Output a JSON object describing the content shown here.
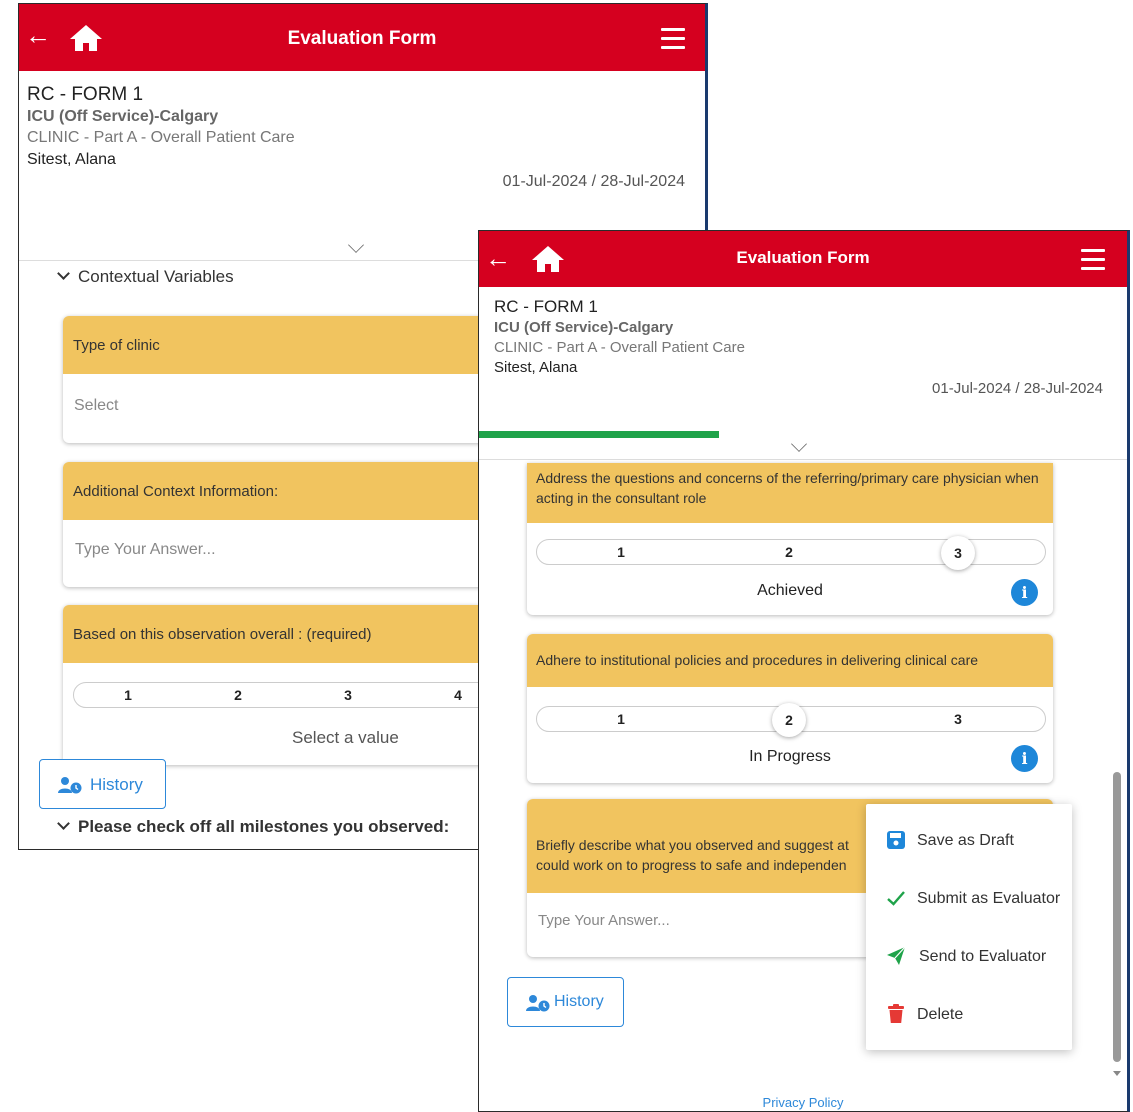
{
  "app": {
    "title": "Evaluation Form",
    "brand_color": "#d5001f",
    "accent_color": "#f1c45f",
    "link_color": "#2d88d9",
    "progress_color": "#1fa34a"
  },
  "form_header": {
    "form_name": "RC - FORM 1",
    "rotation": "ICU (Off Service)-Calgary",
    "subtitle": "CLINIC - Part A - Overall Patient Care",
    "person": "Sitest, Alana",
    "dates": "01-Jul-2024 / 28-Jul-2024"
  },
  "screen1": {
    "section_contextual": "Contextual Variables",
    "card_clinic": {
      "label": "Type of clinic",
      "placeholder": "Select"
    },
    "card_context": {
      "label": "Additional Context Information:",
      "placeholder": "Type Your Answer..."
    },
    "card_overall": {
      "label": "Based on this observation overall : (required)",
      "scale": [
        "1",
        "2",
        "3",
        "4"
      ],
      "status": "Select a value"
    },
    "history_label": "History",
    "section_milestones": "Please check off all milestones you observed:"
  },
  "screen2": {
    "progress": 0.37,
    "card_address": {
      "label": "Address the questions and concerns of the referring/primary care physician when acting in the consultant role",
      "scale": [
        "1",
        "2",
        "3"
      ],
      "selected": "3",
      "status": "Achieved"
    },
    "card_adhere": {
      "label": "Adhere to institutional policies and procedures in delivering clinical care",
      "scale": [
        "1",
        "2",
        "3"
      ],
      "selected": "2",
      "status": "In Progress"
    },
    "card_describe": {
      "label_line1": "Briefly describe what you observed and suggest at",
      "label_line2": "could work on to progress to safe and independen",
      "placeholder": "Type Your Answer..."
    },
    "history_label": "History",
    "privacy_label": "Privacy Policy"
  },
  "action_menu": {
    "items": [
      {
        "label": "Save as Draft",
        "icon": "floppy-disk-icon",
        "color": "#1e87d9"
      },
      {
        "label": "Submit as Evaluator",
        "icon": "checkmark-icon",
        "color": "#1fa34a"
      },
      {
        "label": "Send to Evaluator",
        "icon": "paper-plane-icon",
        "color": "#1fa34a"
      },
      {
        "label": "Delete",
        "icon": "trash-icon",
        "color": "#e53935"
      }
    ]
  }
}
